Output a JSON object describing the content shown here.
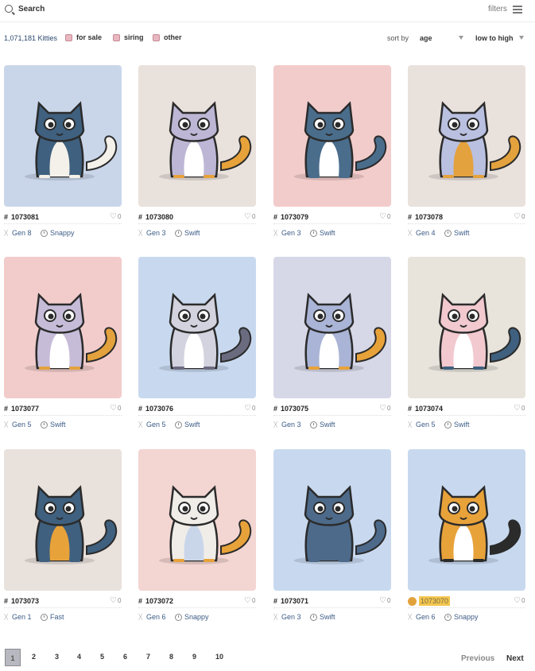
{
  "topbar": {
    "search_label": "Search",
    "filters_label": "filters"
  },
  "filterbar": {
    "count": "1,071,181 Kitties",
    "chips": [
      "for sale",
      "siring",
      "other"
    ],
    "sort_by_label": "sort by",
    "sort_field": "age",
    "sort_order": "low to high"
  },
  "colors": {
    "blue": "#c9d6ea",
    "beige": "#e9e1dc",
    "pink": "#f2cccb",
    "cream": "#e8e4dc",
    "pinkish": "#f3d5d2",
    "lightblue": "#c8d9ef",
    "lavender": "#d6d8e8"
  },
  "kitties": [
    {
      "id": "1073081",
      "likes": "0",
      "gen": "Gen 8",
      "speed": "Snappy",
      "bg": "#c9d6ea",
      "body": "#3f607e",
      "belly": "#f4f1ea",
      "accent": "#f4f1ea"
    },
    {
      "id": "1073080",
      "likes": "0",
      "gen": "Gen 3",
      "speed": "Swift",
      "bg": "#e9e1dc",
      "body": "#bdb6d4",
      "belly": "#ffffff",
      "accent": "#e8a23a"
    },
    {
      "id": "1073079",
      "likes": "0",
      "gen": "Gen 3",
      "speed": "Swift",
      "bg": "#f2cccb",
      "body": "#4a6d8c",
      "belly": "#ffffff",
      "accent": "#4a6d8c"
    },
    {
      "id": "1073078",
      "likes": "0",
      "gen": "Gen 4",
      "speed": "Swift",
      "bg": "#e9e1dc",
      "body": "#b9c0e0",
      "belly": "#e3a23d",
      "accent": "#e3a23d"
    },
    {
      "id": "1073077",
      "likes": "0",
      "gen": "Gen 5",
      "speed": "Swift",
      "bg": "#f2cccb",
      "body": "#c6bcd8",
      "belly": "#ffffff",
      "accent": "#e3a23d"
    },
    {
      "id": "1073076",
      "likes": "0",
      "gen": "Gen 5",
      "speed": "Swift",
      "bg": "#c8d9ef",
      "body": "#d3d3df",
      "belly": "#ffffff",
      "accent": "#6b6b80"
    },
    {
      "id": "1073075",
      "likes": "0",
      "gen": "Gen 3",
      "speed": "Swift",
      "bg": "#d6d8e8",
      "body": "#a9b4d6",
      "belly": "#ffffff",
      "accent": "#e8a23a"
    },
    {
      "id": "1073074",
      "likes": "0",
      "gen": "Gen 5",
      "speed": "Swift",
      "bg": "#e8e4dc",
      "body": "#f1c9cf",
      "belly": "#ffffff",
      "accent": "#3f607e"
    },
    {
      "id": "1073073",
      "likes": "0",
      "gen": "Gen 1",
      "speed": "Fast",
      "bg": "#e9e1dc",
      "body": "#3f607e",
      "belly": "#e8a23a",
      "accent": "#3f607e"
    },
    {
      "id": "1073072",
      "likes": "0",
      "gen": "Gen 6",
      "speed": "Snappy",
      "bg": "#f3d5d2",
      "body": "#f0ede8",
      "belly": "#c9d6ea",
      "accent": "#e8a23a"
    },
    {
      "id": "1073071",
      "likes": "0",
      "gen": "Gen 3",
      "speed": "Swift",
      "bg": "#c8d9ef",
      "body": "#4d6a8a",
      "belly": "#4d6a8a",
      "accent": "#4d6a8a"
    },
    {
      "id": "1073070",
      "likes": "0",
      "gen": "Gen 6",
      "speed": "Snappy",
      "bg": "#c8d9ef",
      "body": "#e8a23a",
      "belly": "#ffffff",
      "accent": "#2b2b2b",
      "for_sale": true
    }
  ],
  "pagination": {
    "current": "1",
    "pages": [
      "2",
      "3",
      "4",
      "5",
      "6",
      "7",
      "8",
      "9",
      "10"
    ],
    "previous_label": "Previous",
    "next_label": "Next"
  }
}
